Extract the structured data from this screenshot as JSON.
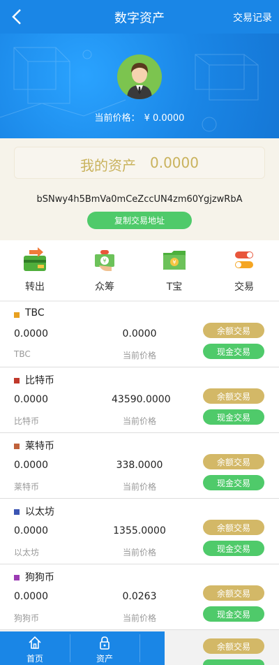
{
  "nav": {
    "title": "数字资产",
    "right_label": "交易记录",
    "back_icon": "chevron-left-icon"
  },
  "hero": {
    "price_label": "当前价格：",
    "price_value": "¥ 0.0000"
  },
  "assets": {
    "label": "我的资产",
    "value": "0.0000",
    "address": "bSNwy4h5BmVa0mCeZccUN4zm60YgjzwRbA",
    "copy_button": "复制交易地址"
  },
  "actions": [
    {
      "label": "转出",
      "icon": "wallet-transfer-icon"
    },
    {
      "label": "众筹",
      "icon": "crowdfund-hand-icon"
    },
    {
      "label": "T宝",
      "icon": "folder-yen-icon"
    },
    {
      "label": "交易",
      "icon": "toggle-trade-icon"
    }
  ],
  "coins": [
    {
      "name": "TBC",
      "balance": "0.0000",
      "price": "0.0000",
      "balance_sub": "TBC",
      "price_sub": "当前价格",
      "color": "#e8a020"
    },
    {
      "name": "比特币",
      "balance": "0.0000",
      "price": "43590.0000",
      "balance_sub": "比特币",
      "price_sub": "当前价格",
      "color": "#c0392b"
    },
    {
      "name": "莱特币",
      "balance": "0.0000",
      "price": "338.0000",
      "balance_sub": "莱特币",
      "price_sub": "当前价格",
      "color": "#c0623b"
    },
    {
      "name": "以太坊",
      "balance": "0.0000",
      "price": "1355.0000",
      "balance_sub": "以太坊",
      "price_sub": "当前价格",
      "color": "#3b55b3"
    },
    {
      "name": "狗狗币",
      "balance": "0.0000",
      "price": "0.0263",
      "balance_sub": "狗狗币",
      "price_sub": "当前价格",
      "color": "#9b3bb3"
    }
  ],
  "coin_buttons": {
    "balance_trade": "余额交易",
    "cash_trade": "现金交易"
  },
  "tabbar": [
    {
      "label": "首页",
      "icon": "home-icon"
    },
    {
      "label": "资产",
      "icon": "lock-icon"
    }
  ],
  "colors": {
    "primary_blue": "#1a86e6",
    "gold": "#d3b867",
    "green": "#4fca6a"
  }
}
